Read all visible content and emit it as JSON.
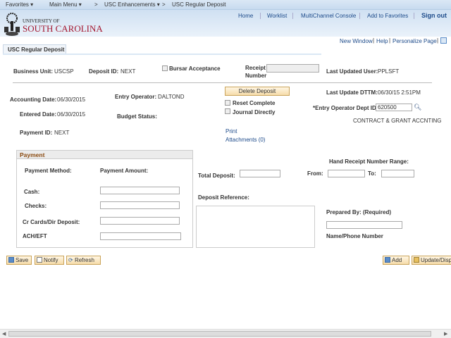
{
  "nav": {
    "favorites": "Favorites ▾",
    "main_menu": "Main Menu ▾",
    "sep1": ">",
    "enhancements": "USC Enhancements ▾",
    "sep2": ">",
    "current": "USC Regular Deposit"
  },
  "header": {
    "logo_top": "UNIVERSITY OF",
    "logo_bottom": "SOUTH CAROLINA",
    "links": [
      "Home",
      "Worklist",
      "MultiChannel Console",
      "Add to Favorites"
    ],
    "sign_out": "Sign out"
  },
  "utility": {
    "new_window": "New Window",
    "help": "Help",
    "personalize": "Personalize Page"
  },
  "tab": "USC Regular Deposit",
  "form": {
    "business_unit_label": "Business Unit:",
    "business_unit": "USCSP",
    "deposit_id_label": "Deposit ID:",
    "deposit_id": "NEXT",
    "bursar_acceptance": "Bursar Acceptance",
    "receipt_label_1": "Receipt",
    "receipt_label_2": "Number",
    "receipt_number": "",
    "last_updated_user_label": "Last Updated User:",
    "last_updated_user": "PPLSFT",
    "delete_deposit": "Delete Deposit",
    "last_update_dttm_label": "Last Update DTTM:",
    "last_update_dttm": "06/30/15  2:51PM",
    "accounting_date_label": "Accounting Date:",
    "accounting_date": "06/30/2015",
    "entry_operator_label": "Entry Operator:",
    "entry_operator": "DALTOND",
    "reset_complete": "Reset Complete",
    "journal_directly": "Journal Directly",
    "entry_dept_label": "*Entry Operator Dept ID:",
    "entry_dept": "620500",
    "dept_desc": "CONTRACT & GRANT ACCNTING",
    "entered_date_label": "Entered Date:",
    "entered_date": "06/30/2015",
    "budget_status_label": "Budget Status:",
    "payment_id_label": "Payment ID:",
    "payment_id": "NEXT",
    "print": "Print",
    "attachments": "Attachments (0)"
  },
  "payment": {
    "title": "Payment",
    "method_header": "Payment Method:",
    "amount_header": "Payment Amount:",
    "rows": [
      {
        "label": "Cash:",
        "value": ""
      },
      {
        "label": "Checks:",
        "value": ""
      },
      {
        "label": "Cr Cards/Dir Deposit:",
        "value": ""
      },
      {
        "label": "ACH/EFT",
        "value": ""
      }
    ]
  },
  "deposit": {
    "total_label": "Total Deposit:",
    "total": "",
    "range_label": "Hand Receipt Number Range:",
    "from_label": "From:",
    "to_label": "To:",
    "reference_label": "Deposit Reference:",
    "prepared_by_label": "Prepared By: (Required)",
    "name_phone": "Name/Phone Number"
  },
  "toolbar": {
    "save": "Save",
    "notify": "Notify",
    "refresh": "Refresh",
    "add": "Add",
    "update": "Update/Display"
  }
}
